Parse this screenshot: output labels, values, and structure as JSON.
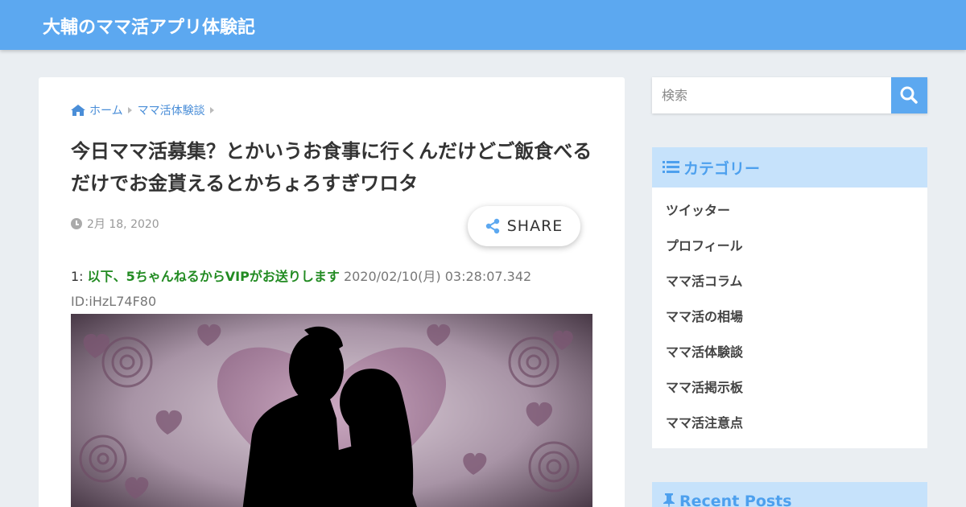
{
  "header": {
    "site_title": "大輔のママ活アプリ体験記"
  },
  "breadcrumb": {
    "home": "ホーム",
    "category": "ママ活体験談"
  },
  "post": {
    "title": "今日ママ活募集？とかいうお食事に行くんだけどご飯食べるだけでお金貰えるとかちょろすぎワロタ",
    "date": "2月 18, 2020",
    "share_label": "SHARE"
  },
  "response": {
    "number": "1: ",
    "name": "以下、5ちゃんねるからVIPがお送りします",
    "meta": " 2020/02/10(月) 03:28:07.342",
    "id": "ID:iHzL74F80"
  },
  "sidebar": {
    "search": {
      "placeholder": "検索"
    },
    "categories": {
      "title": "カテゴリー",
      "items": [
        "ツイッター",
        "プロフィール",
        "ママ活コラム",
        "ママ活の相場",
        "ママ活体験談",
        "ママ活掲示板",
        "ママ活注意点"
      ]
    },
    "recent_posts": {
      "title": "Recent Posts"
    }
  },
  "colors": {
    "header": "#5ca8f0",
    "widget_head": "#c6e2fb",
    "accent_text": "#4da0ee",
    "name_green": "#228b22"
  },
  "icons": [
    "home-icon",
    "clock-icon",
    "share-icon",
    "search-icon",
    "list-icon",
    "pin-icon"
  ]
}
